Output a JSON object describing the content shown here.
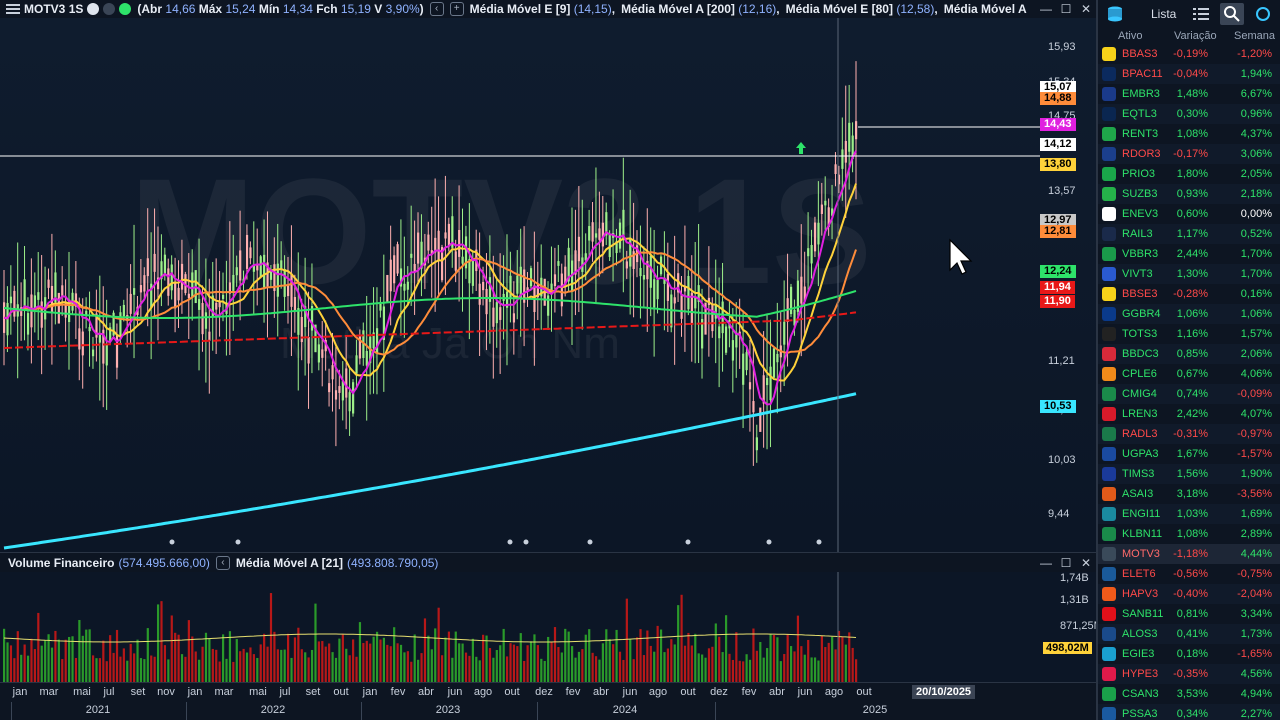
{
  "chart": {
    "symbol": "MOTV3",
    "timeframe": "1S",
    "ohlc": {
      "open_label": "Abr",
      "open": "14,66",
      "high_label": "Máx",
      "high": "15,24",
      "low_label": "Mín",
      "low": "14,34",
      "close_label": "Fch",
      "close": "15,19",
      "var_label": "V",
      "var": "3,90%"
    },
    "indicators": [
      {
        "name": "Média Móvel E [9]",
        "value": "(14,15)"
      },
      {
        "name": "Média Móvel A [200]",
        "value": "(12,16)"
      },
      {
        "name": "Média Móvel E [80]",
        "value": "(12,58)"
      },
      {
        "name": "Média Móvel A",
        "value": ""
      }
    ],
    "watermark": "MOTV3 1S",
    "watermark_sub": "Motiva Ja On Nm",
    "price_axis": [
      "15,93",
      "15,34",
      "14,75",
      "13,57",
      "12,39",
      "11,21",
      "10,62",
      "10,03",
      "9,44"
    ],
    "price_labels": [
      {
        "text": "15,07",
        "bg": "#ffffff",
        "fg": "#000000"
      },
      {
        "text": "14,88",
        "bg": "#ff8c3a",
        "fg": "#000000"
      },
      {
        "text": "14,43",
        "bg": "#e020e0",
        "fg": "#ffffff"
      },
      {
        "text": "14,12",
        "bg": "#ffffff",
        "fg": "#000000"
      },
      {
        "text": "13,80",
        "bg": "#ffd23a",
        "fg": "#000000"
      },
      {
        "text": "12,97",
        "bg": "#c8c8c8",
        "fg": "#000000"
      },
      {
        "text": "12,81",
        "bg": "#ff8c3a",
        "fg": "#000000"
      },
      {
        "text": "12,24",
        "bg": "#2ee36a",
        "fg": "#000000"
      },
      {
        "text": "11,94",
        "bg": "#e81818",
        "fg": "#ffffff"
      },
      {
        "text": "11,90",
        "bg": "#e81818",
        "fg": "#ffffff"
      },
      {
        "text": "10,53",
        "bg": "#39e6ff",
        "fg": "#000000"
      }
    ],
    "volume": {
      "title": "Volume Financeiro",
      "value": "(574.495.666,00)",
      "ma_title": "Média Móvel A [21]",
      "ma_value": "(493.808.790,05)",
      "axis": [
        "1,74B",
        "1,31B",
        "871,25M",
        "498,02M"
      ]
    },
    "months": [
      "jan",
      "mar",
      "mai",
      "jul",
      "set",
      "nov",
      "jan",
      "mar",
      "mai",
      "jul",
      "set",
      "out",
      "jan",
      "fev",
      "abr",
      "jun",
      "ago",
      "out",
      "dez",
      "fev",
      "abr",
      "jun",
      "ago",
      "out",
      "dez",
      "fev",
      "abr",
      "jun",
      "ago",
      "out"
    ],
    "years": [
      "2021",
      "2022",
      "2023",
      "2024",
      "2025"
    ],
    "crosshair_date": "20/10/2025",
    "colors": {
      "up": "#9ef08a",
      "down": "#ffb0b0",
      "ema9": "#e020e0",
      "sma200": "#39e6ff",
      "ema80": "#ff8c3a",
      "ma_yellow": "#ffd23a",
      "ma_green": "#2ee36a",
      "ma_red": "#e81818"
    }
  },
  "panel": {
    "title": "Lista",
    "col_asset": "Ativo",
    "col_var": "Variação",
    "col_week": "Semana",
    "rows": [
      {
        "tk": "BBAS3",
        "v": "-0,19%",
        "w": "-1,20%",
        "c": "#f7d21a"
      },
      {
        "tk": "BPAC11",
        "v": "-0,04%",
        "w": "1,94%",
        "c": "#0b2a5e"
      },
      {
        "tk": "EMBR3",
        "v": "1,48%",
        "w": "6,67%",
        "c": "#1a3a8a"
      },
      {
        "tk": "EQTL3",
        "v": "0,30%",
        "w": "0,96%",
        "c": "#0a2650"
      },
      {
        "tk": "RENT3",
        "v": "1,08%",
        "w": "4,37%",
        "c": "#1fa64a"
      },
      {
        "tk": "RDOR3",
        "v": "-0,17%",
        "w": "3,06%",
        "c": "#1b3f8c"
      },
      {
        "tk": "PRIO3",
        "v": "1,80%",
        "w": "2,05%",
        "c": "#1aa64a"
      },
      {
        "tk": "SUZB3",
        "v": "0,93%",
        "w": "2,18%",
        "c": "#25b24a"
      },
      {
        "tk": "ENEV3",
        "v": "0,60%",
        "w": "0,00%",
        "c": "#ffffff"
      },
      {
        "tk": "RAIL3",
        "v": "1,17%",
        "w": "0,52%",
        "c": "#1a2a4a"
      },
      {
        "tk": "VBBR3",
        "v": "2,44%",
        "w": "1,70%",
        "c": "#1a9a4a"
      },
      {
        "tk": "VIVT3",
        "v": "1,30%",
        "w": "1,70%",
        "c": "#2a5ad0"
      },
      {
        "tk": "BBSE3",
        "v": "-0,28%",
        "w": "0,16%",
        "c": "#f7d21a"
      },
      {
        "tk": "GGBR4",
        "v": "1,06%",
        "w": "1,06%",
        "c": "#0a3a8a"
      },
      {
        "tk": "TOTS3",
        "v": "1,16%",
        "w": "1,57%",
        "c": "#222222"
      },
      {
        "tk": "BBDC3",
        "v": "0,85%",
        "w": "2,06%",
        "c": "#d82a3a"
      },
      {
        "tk": "CPLE6",
        "v": "0,67%",
        "w": "4,06%",
        "c": "#f08a1a"
      },
      {
        "tk": "CMIG4",
        "v": "0,74%",
        "w": "-0,09%",
        "c": "#1a8a4a"
      },
      {
        "tk": "LREN3",
        "v": "2,42%",
        "w": "4,07%",
        "c": "#d81a2a"
      },
      {
        "tk": "RADL3",
        "v": "-0,31%",
        "w": "-0,97%",
        "c": "#1a7a4a"
      },
      {
        "tk": "UGPA3",
        "v": "1,67%",
        "w": "-1,57%",
        "c": "#1a4aa0"
      },
      {
        "tk": "TIMS3",
        "v": "1,56%",
        "w": "1,90%",
        "c": "#1a3a9a"
      },
      {
        "tk": "ASAI3",
        "v": "3,18%",
        "w": "-3,56%",
        "c": "#e05a1a"
      },
      {
        "tk": "ENGI11",
        "v": "1,03%",
        "w": "1,69%",
        "c": "#1a8aa0"
      },
      {
        "tk": "KLBN11",
        "v": "1,08%",
        "w": "2,89%",
        "c": "#1a8a4a"
      },
      {
        "tk": "MOTV3",
        "v": "-1,18%",
        "w": "4,44%",
        "c": "#3a4a5a"
      },
      {
        "tk": "ELET6",
        "v": "-0,56%",
        "w": "-0,75%",
        "c": "#1a5a9a"
      },
      {
        "tk": "HAPV3",
        "v": "-0,40%",
        "w": "-2,04%",
        "c": "#f05a1a"
      },
      {
        "tk": "SANB11",
        "v": "0,81%",
        "w": "3,34%",
        "c": "#e0101a"
      },
      {
        "tk": "ALOS3",
        "v": "0,41%",
        "w": "1,73%",
        "c": "#1a4a8a"
      },
      {
        "tk": "EGIE3",
        "v": "0,18%",
        "w": "-1,65%",
        "c": "#1aa0d0"
      },
      {
        "tk": "HYPE3",
        "v": "-0,35%",
        "w": "4,56%",
        "c": "#e01a4a"
      },
      {
        "tk": "CSAN3",
        "v": "3,53%",
        "w": "4,94%",
        "c": "#1aa04a"
      },
      {
        "tk": "PSSA3",
        "v": "0,34%",
        "w": "2,27%",
        "c": "#1a5aa0"
      }
    ]
  }
}
